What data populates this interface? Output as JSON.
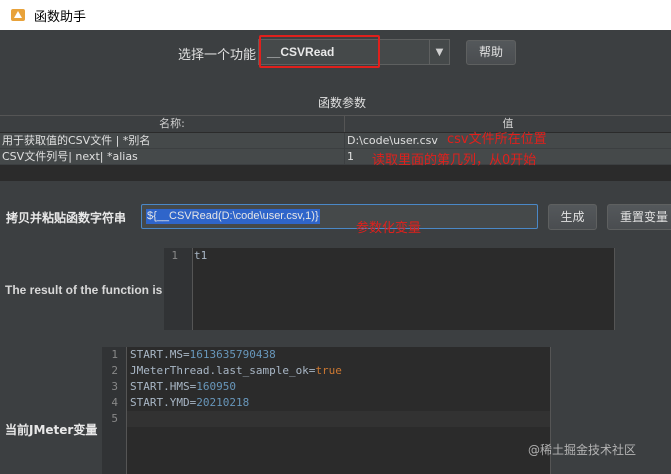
{
  "window": {
    "title": "函数助手"
  },
  "function_select": {
    "label": "选择一个功能",
    "value": "__CSVRead",
    "help_label": "帮助"
  },
  "params": {
    "title": "函数参数",
    "columns": [
      "名称:",
      "值"
    ],
    "rows": [
      {
        "name": "用于获取值的CSV文件 | *别名",
        "value": "D:\\code\\user.csv"
      },
      {
        "name": "CSV文件列号| next| *alias",
        "value": "1"
      }
    ]
  },
  "annotations": {
    "csv_location": "csv文件所在位置",
    "column_note": "读取里面的第几列，从0开始",
    "param_var": "参数化变量"
  },
  "copy": {
    "label": "拷贝并粘贴函数字符串",
    "value": "${__CSVRead(D:\\code\\user.csv,1)}",
    "generate_label": "生成",
    "reset_label": "重置变量"
  },
  "result": {
    "label": "The result of the function is",
    "line_numbers": [
      "1"
    ],
    "lines": [
      "t1"
    ]
  },
  "vars": {
    "label": "当前JMeter变量",
    "line_numbers": [
      "1",
      "2",
      "3",
      "4",
      "5"
    ],
    "lines": [
      {
        "key": "START.MS=",
        "val": "1613635790438"
      },
      {
        "key": "JMeterThread.last_sample_ok=",
        "val": "true"
      },
      {
        "key": "START.HMS=",
        "val": "160950"
      },
      {
        "key": "START.YMD=",
        "val": "20210218"
      },
      {
        "key": "",
        "val": ""
      }
    ]
  },
  "watermark": "@稀土掘金技术社区",
  "colors": {
    "accent_red": "#e0201c",
    "selection_blue": "#2f65ca",
    "background": "#3c3f41"
  }
}
